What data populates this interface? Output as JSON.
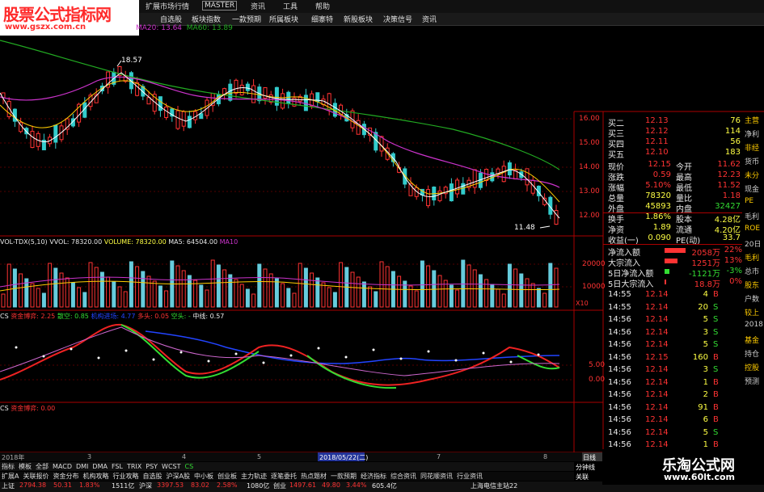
{
  "watermark": {
    "title": "股票公式指标网",
    "url": "www.gszx.com.cn",
    "brand": "乐淘公式网",
    "brand_url": "www.60lt.com"
  },
  "top_menu": [
    "扩展市场行情",
    "MASTER",
    "资讯",
    "工具",
    "帮助"
  ],
  "nav": [
    "自选股",
    "板块指数",
    "一款预期",
    "所属板块",
    "细寨特",
    "新股板块",
    "决策信号",
    "资讯"
  ],
  "ma_legend": {
    "ma20": "MA20: 13.64",
    "ma60": "MA60: 13.89"
  },
  "price_labels": {
    "high": "18.57",
    "low": "11.48"
  },
  "price_axis": [
    "16.00",
    "15.00",
    "14.00",
    "13.00",
    "12.00"
  ],
  "volume_legend": {
    "name": "VOL-TDX(5,10)",
    "vvol": "VVOL: 78320.00",
    "volume": "VOLUME: 78320.00",
    "ma5": "MA5: 64504.00",
    "ma10": "MA10"
  },
  "volume_axis": [
    "20000",
    "10000",
    "X10"
  ],
  "cs_legend": {
    "name": "CS",
    "a": "资金博弈: 2.25",
    "b": "散空: 0.85",
    "c": "机构进场: 4.77",
    "d": "多头: 0.05",
    "e": "空头: -",
    "f": "中线: 0.57"
  },
  "cs_axis": [
    "5.00",
    "0.00"
  ],
  "cs2_legend": {
    "name": "CS",
    "a": "资金博弈: 0.00"
  },
  "date_axis": {
    "year": "2018年",
    "m3": "3",
    "m4": "4",
    "m5": "5",
    "selected": "2018/05/22(二)",
    "m7": "7",
    "m8": "8"
  },
  "quote": {
    "bids": [
      {
        "label": "买二",
        "price": "12.13",
        "vol": "76"
      },
      {
        "label": "买三",
        "price": "12.12",
        "vol": "114"
      },
      {
        "label": "买四",
        "price": "12.11",
        "vol": "56"
      },
      {
        "label": "买五",
        "price": "12.10",
        "vol": "183"
      }
    ],
    "stats": [
      {
        "l1": "现价",
        "v1": "12.15",
        "l2": "今开",
        "v2": "11.62"
      },
      {
        "l1": "涨跌",
        "v1": "0.59",
        "l2": "最高",
        "v2": "12.23"
      },
      {
        "l1": "涨幅",
        "v1": "5.10%",
        "l2": "最低",
        "v2": "11.52"
      },
      {
        "l1": "总量",
        "v1": "78320",
        "l2": "量比",
        "v2": "1.18"
      },
      {
        "l1": "外盘",
        "v1": "45893",
        "l2": "内盘",
        "v2": "32427"
      },
      {
        "l1": "换手",
        "v1": "1.86%",
        "l2": "股本",
        "v2": "4.28亿"
      },
      {
        "l1": "净资",
        "v1": "1.89",
        "l2": "流通",
        "v2": "4.20亿"
      },
      {
        "l1": "收益(一)",
        "v1": "0.090",
        "l2": "PE(动)",
        "v2": "33.7"
      }
    ],
    "flows": [
      {
        "label": "净流入额",
        "value": "2058万",
        "pct": "22%"
      },
      {
        "label": "大宗流入",
        "value": "1251万",
        "pct": "13%"
      },
      {
        "label": "5日净流入额",
        "value": "-1121万",
        "pct": "-3%"
      },
      {
        "label": "5日大宗流入",
        "value": "18.8万",
        "pct": "0%"
      }
    ],
    "ticks": [
      {
        "t": "14:55",
        "p": "12.14",
        "v": "4",
        "d": "B"
      },
      {
        "t": "14:55",
        "p": "12.14",
        "v": "20",
        "d": "S"
      },
      {
        "t": "14:56",
        "p": "12.14",
        "v": "5",
        "d": "S"
      },
      {
        "t": "14:56",
        "p": "12.14",
        "v": "3",
        "d": "S"
      },
      {
        "t": "14:56",
        "p": "12.14",
        "v": "5",
        "d": "S"
      },
      {
        "t": "14:56",
        "p": "12.15",
        "v": "160",
        "d": "B"
      },
      {
        "t": "14:56",
        "p": "12.14",
        "v": "3",
        "d": "S"
      },
      {
        "t": "14:56",
        "p": "12.14",
        "v": "1",
        "d": "B"
      },
      {
        "t": "14:56",
        "p": "12.14",
        "v": "2",
        "d": "B"
      },
      {
        "t": "14:56",
        "p": "12.14",
        "v": "91",
        "d": "B"
      },
      {
        "t": "14:56",
        "p": "12.14",
        "v": "6",
        "d": "B"
      },
      {
        "t": "14:56",
        "p": "12.14",
        "v": "5",
        "d": "S"
      },
      {
        "t": "14:56",
        "p": "12.14",
        "v": "1",
        "d": "B"
      },
      {
        "t": "14:56",
        "p": "12.14",
        "v": "11",
        "d": "B"
      }
    ]
  },
  "far_right": [
    "主营",
    "净利",
    "非经",
    "货币",
    "未分",
    "现金",
    "PE",
    "毛利",
    "ROE",
    "20日",
    "毛利",
    "总市",
    "股东",
    "户数",
    "较上",
    "2018",
    "基金",
    "持仓",
    "控股",
    "预测"
  ],
  "tabs1": [
    "指标",
    "模板",
    "全部",
    "MACD",
    "DMI",
    "DMA",
    "FSL",
    "TRIX",
    "PSY",
    "WCST",
    "CS"
  ],
  "tabs2": [
    "扩展A",
    "关联报价",
    "资金分布",
    "机构攻略",
    "行业攻略",
    "自选股",
    "沪深A股",
    "中小板",
    "创业板",
    "主力轨迹",
    "逐笔委托",
    "热点题材",
    "一款预期",
    "经济指标",
    "综合资讯",
    "同花顺资讯",
    "行业资讯"
  ],
  "right_tabs": [
    "日线",
    "分钟线",
    "关联"
  ],
  "status": {
    "sh": "上证",
    "sh_v": "2794.38",
    "sh_c": "50.31",
    "sh_p": "1.83%",
    "sh_a": "1511亿",
    "hs": "沪深",
    "hs_v": "3397.53",
    "hs_c": "83.02",
    "hs_p": "2.58%",
    "hs_a": "1080亿",
    "cy": "创业",
    "cy_v": "1497.61",
    "cy_c": "49.80",
    "cy_p": "3.44%",
    "cy_a": "605.4亿",
    "server": "上海电信主站22"
  },
  "colors": {
    "up": "#ff3333",
    "down": "#33cccc",
    "ma5": "#ffffff",
    "ma10": "#ffcc00",
    "ma20": "#cc33cc",
    "ma60": "#22aa22"
  }
}
